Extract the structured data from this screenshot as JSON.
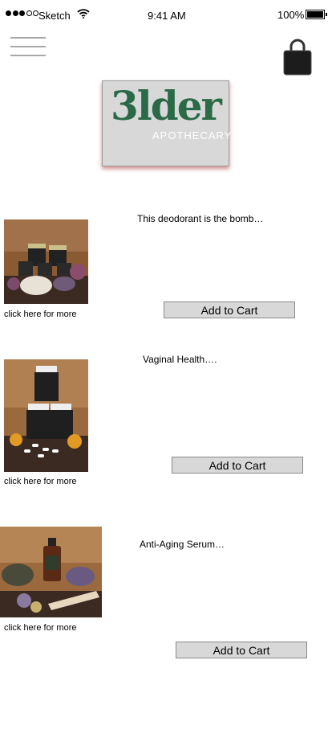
{
  "status_bar": {
    "carrier": "Sketch",
    "time": "9:41 AM",
    "battery": "100%"
  },
  "header": {
    "menu_icon": "hamburger-menu-icon",
    "cart_icon": "shopping-bag-icon",
    "logo_text": "3lder",
    "logo_subtext": "APOTHECARY"
  },
  "products": [
    {
      "description": "This deodorant is the bomb…",
      "more_link": "click here for more",
      "button": "Add to Cart"
    },
    {
      "description": "Vaginal Health….",
      "more_link": "click here for more",
      "button": "Add to Cart"
    },
    {
      "description": "Anti-Aging Serum…",
      "more_link": "click here for more",
      "button": "Add to Cart"
    }
  ],
  "colors": {
    "logo_green": "#2a6a47",
    "logo_bg": "#d8d8d8",
    "button_bg": "#d8d8d8"
  }
}
